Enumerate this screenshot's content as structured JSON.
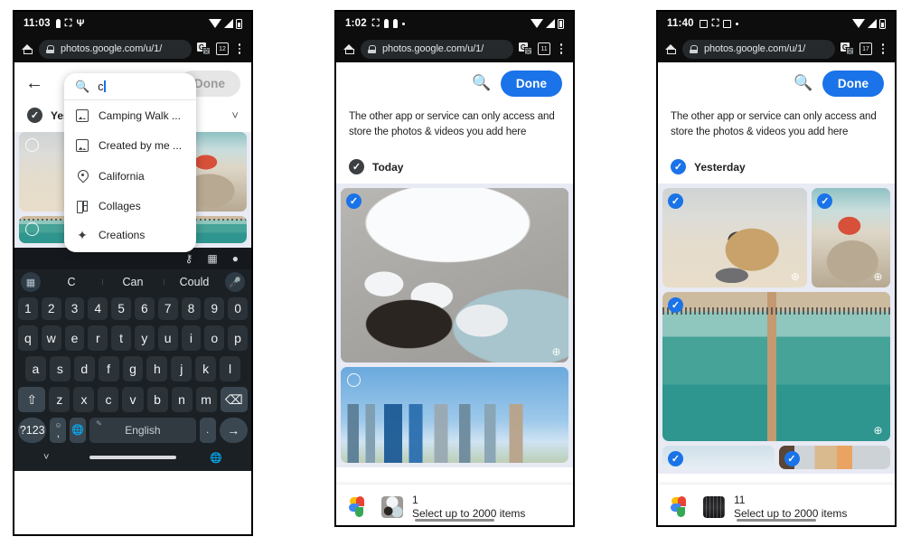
{
  "phones": [
    {
      "id": "phone-search-keyboard",
      "status": {
        "time": "11:03",
        "left_icons": [
          "person-icon",
          "gmail-icon",
          "antenna-icon"
        ],
        "right_icons": [
          "wifi-icon",
          "signal-icon",
          "battery-icon"
        ]
      },
      "browser": {
        "home_icon": "home-icon",
        "lock_icon": "permissions-icon",
        "url": "photos.google.com/u/1/",
        "translate_icon": "translate-icon",
        "tabs_icon": "tab-count-icon",
        "tabs_count": "12",
        "menu_icon": "kebab-menu-icon"
      },
      "app": {
        "back_icon": "back-arrow-icon",
        "done_label": "Done",
        "done_state": "disabled",
        "section_label": "Yeste",
        "chevron_icon": "chevron-down-icon"
      },
      "suggestions": {
        "search_icon": "search-icon",
        "query": "c",
        "items": [
          {
            "icon": "photo-icon",
            "label": "Camping Walk ..."
          },
          {
            "icon": "photo-icon",
            "label": "Created by me ..."
          },
          {
            "icon": "location-pin-icon",
            "label": "California"
          },
          {
            "icon": "collage-icon",
            "label": "Collages"
          },
          {
            "icon": "sparkle-icon",
            "label": "Creations"
          }
        ]
      },
      "keyboard": {
        "toolbar_icons": [
          "key-icon",
          "card-icon",
          "location-icon"
        ],
        "grid_icon": "clipboard-grid-icon",
        "mic_icon": "microphone-icon",
        "suggestions": [
          "C",
          "Can",
          "Could"
        ],
        "row_numbers": [
          "1",
          "2",
          "3",
          "4",
          "5",
          "6",
          "7",
          "8",
          "9",
          "0"
        ],
        "row_top": [
          "q",
          "w",
          "e",
          "r",
          "t",
          "y",
          "u",
          "i",
          "o",
          "p"
        ],
        "row_mid": [
          "a",
          "s",
          "d",
          "f",
          "g",
          "h",
          "j",
          "k",
          "l"
        ],
        "row_bottom": [
          "z",
          "x",
          "c",
          "v",
          "b",
          "n",
          "m"
        ],
        "shift_icon": "shift-icon",
        "backspace_icon": "backspace-icon",
        "symbols_label": "?123",
        "emoji_icon": "emoji-comma-icon",
        "globe_icon": "language-globe-icon",
        "space_label": "English",
        "space_hint_icon": "handwriting-icon",
        "period_label": ".",
        "enter_icon": "enter-arrow-icon",
        "nav_down_icon": "collapse-keyboard-icon",
        "nav_globe_icon": "ime-globe-icon"
      }
    },
    {
      "id": "phone-today-one-selected",
      "status": {
        "time": "1:02",
        "left_icons": [
          "gmail-icon",
          "person-icon",
          "person-icon",
          "dot-icon"
        ],
        "right_icons": [
          "wifi-icon",
          "signal-icon",
          "battery-icon"
        ]
      },
      "browser": {
        "home_icon": "home-icon",
        "lock_icon": "permissions-icon",
        "url": "photos.google.com/u/1/",
        "translate_icon": "translate-icon",
        "tabs_icon": "tab-count-icon",
        "tabs_count": "11",
        "menu_icon": "kebab-menu-icon"
      },
      "app": {
        "search_icon": "search-icon",
        "done_label": "Done",
        "done_state": "active",
        "notice": "The other app or service can only access and store the photos & videos you add here",
        "section_label": "Today",
        "section_state": "checked-dark"
      },
      "tiles": [
        {
          "name": "photo-korean-food",
          "selected": true,
          "zoom_icon": "zoom-in-icon"
        },
        {
          "name": "photo-city-skyline",
          "selected": false,
          "zoom_icon": null
        }
      ],
      "sheet": {
        "logo": "google-photos-logo",
        "thumb": "selected-photo-thumbnail",
        "count": "1",
        "subtitle": "Select up to 2000 items"
      }
    },
    {
      "id": "phone-yesterday-eleven-selected",
      "status": {
        "time": "11:40",
        "left_icons": [
          "message-icon",
          "gmail-icon",
          "calendar-icon",
          "dot-icon"
        ],
        "right_icons": [
          "wifi-icon",
          "signal-icon",
          "battery-icon"
        ]
      },
      "browser": {
        "home_icon": "home-icon",
        "lock_icon": "permissions-icon",
        "url": "photos.google.com/u/1/",
        "translate_icon": "translate-icon",
        "tabs_icon": "tab-count-icon",
        "tabs_count": "17",
        "menu_icon": "kebab-menu-icon"
      },
      "app": {
        "search_icon": "search-icon",
        "done_label": "Done",
        "done_state": "active",
        "notice": "The other app or service can only access and store the photos & videos you add here",
        "section_label": "Yesterday",
        "section_state": "checked-blue"
      },
      "tiles": [
        {
          "name": "photo-beach-bag",
          "selected": true,
          "zoom_icon": "zoom-in-icon"
        },
        {
          "name": "photo-beach-rocks",
          "selected": true,
          "zoom_icon": "zoom-in-icon"
        },
        {
          "name": "photo-aerial-pier",
          "selected": true,
          "zoom_icon": "zoom-in-icon"
        },
        {
          "name": "photo-strip-sky",
          "selected": true,
          "zoom_icon": null
        },
        {
          "name": "photo-strip-food",
          "selected": true,
          "zoom_icon": null
        }
      ],
      "sheet": {
        "logo": "google-photos-logo",
        "thumb": "selected-photo-thumbnail",
        "count": "11",
        "subtitle": "Select up to 2000 items"
      }
    }
  ]
}
